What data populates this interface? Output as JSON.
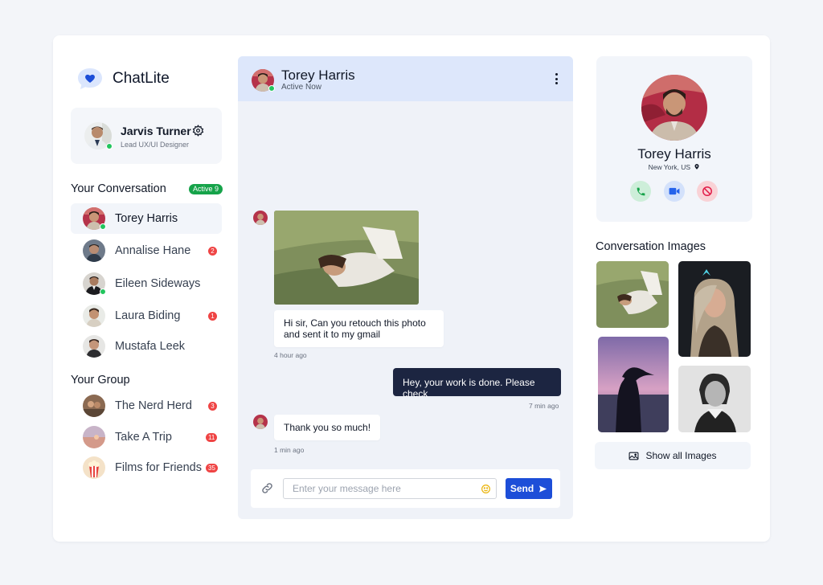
{
  "app": {
    "name": "ChatLite"
  },
  "colors": {
    "accent": "#1d4ed8",
    "online": "#22c55e",
    "badge": "#ef4444",
    "active": "#16a34a",
    "dark_bubble": "#1c2541"
  },
  "user": {
    "name": "Jarvis Turner",
    "role": "Lead UX/UI Designer",
    "online": true
  },
  "conversations": {
    "title": "Your Conversation",
    "active_badge": "Active 9",
    "items": [
      {
        "name": "Torey Harris",
        "selected": true,
        "online": true,
        "unread": ""
      },
      {
        "name": "Annalise Hane",
        "selected": false,
        "online": false,
        "unread": "2"
      },
      {
        "name": "Eileen Sideways",
        "selected": false,
        "online": true,
        "unread": ""
      },
      {
        "name": "Laura Biding",
        "selected": false,
        "online": false,
        "unread": "1"
      },
      {
        "name": "Mustafa Leek",
        "selected": false,
        "online": false,
        "unread": ""
      }
    ]
  },
  "groups": {
    "title": "Your Group",
    "items": [
      {
        "name": "The Nerd Herd",
        "unread": "3"
      },
      {
        "name": "Take A Trip",
        "unread": "11"
      },
      {
        "name": "Films for Friends",
        "unread": "35"
      }
    ]
  },
  "chat": {
    "contact_name": "Torey Harris",
    "status": "Active Now",
    "messages": [
      {
        "from": "contact",
        "type": "image"
      },
      {
        "from": "contact",
        "text": "Hi sir, Can you retouch this photo and sent it to my gmail",
        "time": "4 hour ago"
      },
      {
        "from": "me",
        "text": "Hey, your work is done. Please check",
        "time": "7 min ago"
      },
      {
        "from": "contact",
        "text": "Thank you so much!",
        "time": "1 min ago"
      }
    ],
    "input_placeholder": "Enter your message here",
    "input_value": "",
    "send_label": "Send"
  },
  "contact": {
    "name": "Torey Harris",
    "location": "New York, US",
    "actions": [
      "phone-icon",
      "video-icon",
      "block-icon"
    ]
  },
  "gallery": {
    "title": "Conversation Images",
    "show_all_label": "Show all Images"
  }
}
